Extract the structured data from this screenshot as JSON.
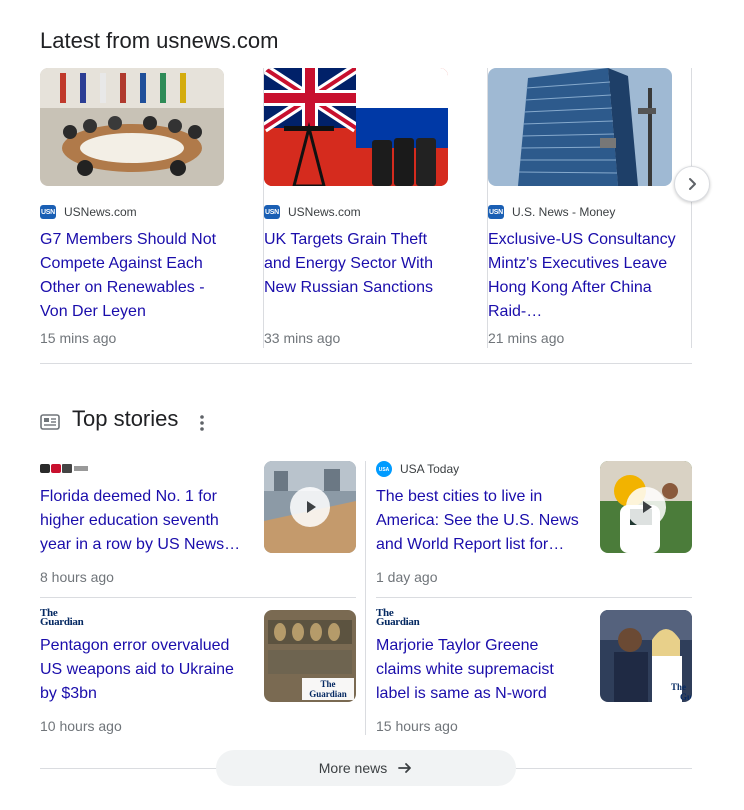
{
  "latest": {
    "title": "Latest from usnews.com",
    "cards": [
      {
        "source": "USNews.com",
        "favicon": "USN",
        "headline": "G7 Members Should Not Compete Against Each Other on Renewables - Von Der Leyen",
        "time": "15 mins ago"
      },
      {
        "source": "USNews.com",
        "favicon": "USN",
        "headline": "UK Targets Grain Theft and Energy Sector With New Russian Sanctions",
        "time": "33 mins ago"
      },
      {
        "source": "U.S. News - Money",
        "favicon": "USN",
        "headline": "Exclusive-US Consultancy Mintz's Executives Leave Hong Kong After China Raid-…",
        "time": "21 mins ago"
      }
    ]
  },
  "top_stories": {
    "title": "Top stories",
    "stories": [
      {
        "source": "",
        "headline": "Florida deemed No. 1 for higher education seventh year in a row by US News…",
        "time": "8 hours ago",
        "video": true
      },
      {
        "source": "USA Today",
        "headline": "The best cities to live in America: See the U.S. News and World Report list for…",
        "time": "1 day ago",
        "video": true
      },
      {
        "source": "",
        "headline": "Pentagon error overvalued US weapons aid to Ukraine by $3bn",
        "time": "10 hours ago",
        "video": false
      },
      {
        "source": "",
        "headline": "Marjorie Taylor Greene claims white supremacist label is same as N-word",
        "time": "15 hours ago",
        "video": false
      }
    ],
    "logos": {
      "guardian_line1": "The",
      "guardian_line2": "Guardian"
    }
  },
  "more_news": {
    "label": "More news"
  },
  "colors": {
    "link": "#1a0dab",
    "meta": "#70757a",
    "divider": "#dadce0",
    "button_bg": "#f1f3f4"
  }
}
